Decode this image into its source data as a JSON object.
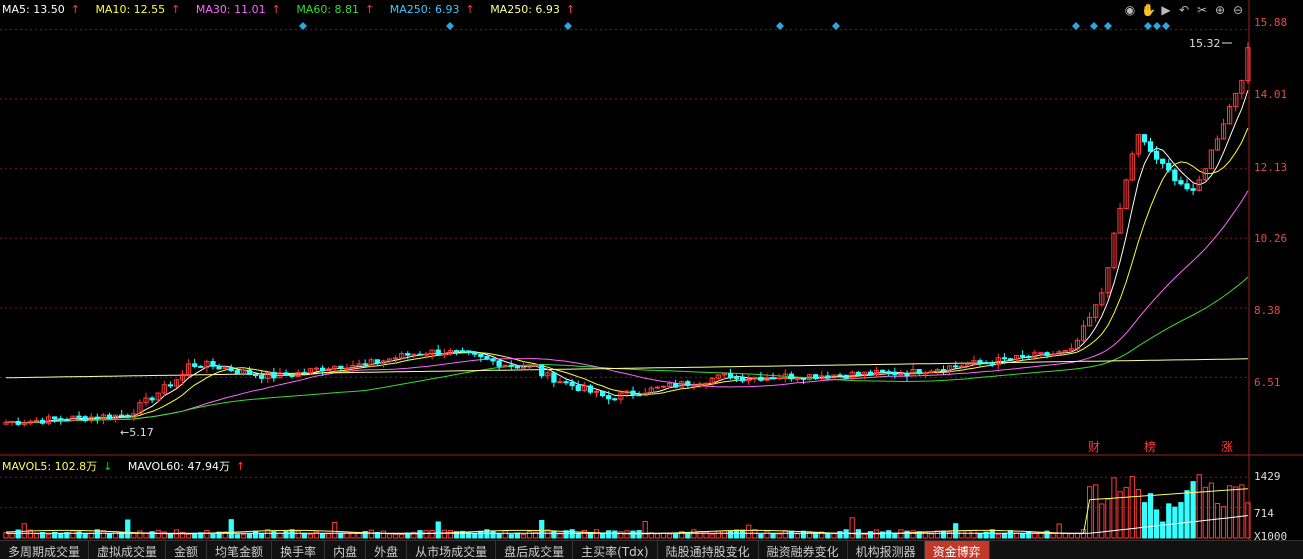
{
  "legend": {
    "ma5": "MA5: 13.50",
    "ma10": "MA10: 12.55",
    "ma30": "MA30: 11.01",
    "ma60": "MA60: 8.81",
    "ma250a": "MA250: 6.93",
    "ma250b": "MA250: 6.93",
    "up": "↑"
  },
  "colors": {
    "ma5": "#ffffff",
    "ma10": "#ffff33",
    "ma30": "#ff66ff",
    "ma60": "#33dd33",
    "ma250a": "#33ccff",
    "ma250b": "#ffff99",
    "up": "#ff3b3b",
    "down": "#33ffff",
    "grid": "#7a1a1a",
    "axis": "#e24a4a"
  },
  "volume_legend": {
    "mavol5": "MAVOL5: 102.8万",
    "mavol5_arrow": "↓",
    "mavol60": "MAVOL60: 47.94万",
    "mavol60_arrow": "↑"
  },
  "toolbar_icons": [
    "eye-icon",
    "hand-icon",
    "play-icon",
    "undo-icon",
    "scissors-icon",
    "zoom-in-icon",
    "zoom-out-icon"
  ],
  "price_axis": [
    "15.88",
    "14.01",
    "12.13",
    "10.26",
    "8.38",
    "6.51"
  ],
  "volume_axis": [
    "1429",
    "714",
    "X1000"
  ],
  "annotations": {
    "max_label": "15.32",
    "min_label": "5.17",
    "event_cai": "财",
    "event_bang": "榜",
    "event_zhang": "涨"
  },
  "tabs": [
    "多周期成交量",
    "虚拟成交量",
    "金额",
    "均笔金额",
    "换手率",
    "内盘",
    "外盘",
    "从市场成交量",
    "盘后成交量",
    "主买率(Tdx)",
    "陆股通持股变化",
    "融资融券变化",
    "机构报测器",
    "资金博弈"
  ],
  "chart_data": {
    "type": "candlestick",
    "price_ticks": [
      15.88,
      14.01,
      12.13,
      10.26,
      8.38,
      6.51
    ],
    "ylim": [
      4.5,
      16.3
    ],
    "volume_ylim": [
      0,
      1600
    ],
    "max_price": 15.32,
    "min_price": 5.17,
    "ma_latest": {
      "MA5": 13.5,
      "MA10": 12.55,
      "MA30": 11.01,
      "MA60": 8.81,
      "MA250": 6.93
    }
  }
}
